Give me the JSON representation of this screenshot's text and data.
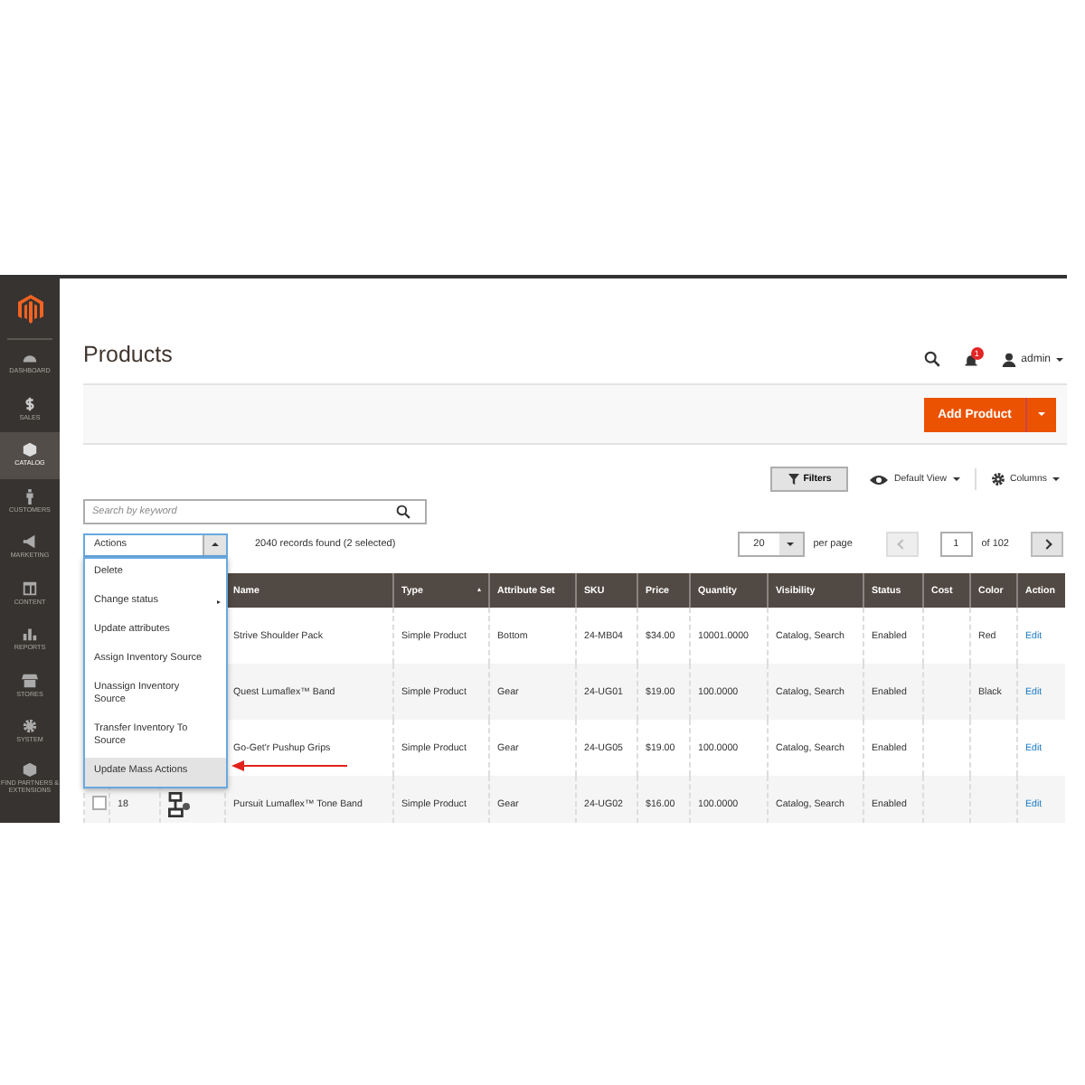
{
  "sidebar": {
    "items": [
      {
        "label": "DASHBOARD",
        "selected": false
      },
      {
        "label": "SALES",
        "selected": false
      },
      {
        "label": "CATALOG",
        "selected": true
      },
      {
        "label": "CUSTOMERS",
        "selected": false
      },
      {
        "label": "MARKETING",
        "selected": false
      },
      {
        "label": "CONTENT",
        "selected": false
      },
      {
        "label": "REPORTS",
        "selected": false
      },
      {
        "label": "STORES",
        "selected": false
      },
      {
        "label": "SYSTEM",
        "selected": false
      },
      {
        "label": "FIND PARTNERS & EXTENSIONS",
        "selected": false
      }
    ]
  },
  "page_title": "Products",
  "header": {
    "notifications": "1",
    "user": "admin"
  },
  "add_button": "Add Product",
  "toolbar": {
    "filters": "Filters",
    "view": "Default View",
    "columns": "Columns"
  },
  "search": {
    "placeholder": "Search by keyword"
  },
  "actions": {
    "label": "Actions",
    "expanded": true,
    "menu": [
      {
        "label": "Delete",
        "has_submenu": false,
        "selected": false
      },
      {
        "label": "Change status",
        "has_submenu": true,
        "selected": false
      },
      {
        "label": "Update attributes",
        "has_submenu": false,
        "selected": false
      },
      {
        "label": "Assign Inventory Source",
        "has_submenu": false,
        "selected": false
      },
      {
        "label": "Unassign Inventory Source",
        "has_submenu": false,
        "selected": false
      },
      {
        "label": "Transfer Inventory To Source",
        "has_submenu": false,
        "selected": false
      },
      {
        "label": "Update Mass Actions",
        "has_submenu": false,
        "selected": true
      }
    ]
  },
  "records": "2040 records found (2 selected)",
  "pager": {
    "per_page": "20",
    "per_page_label": "per page",
    "page": "1",
    "of": "of 102"
  },
  "table": {
    "columns": [
      {
        "label": "Name",
        "sorted": false
      },
      {
        "label": "Type",
        "sorted": true
      },
      {
        "label": "Attribute Set",
        "sorted": false
      },
      {
        "label": "SKU",
        "sorted": false
      },
      {
        "label": "Price",
        "sorted": false
      },
      {
        "label": "Quantity",
        "sorted": false
      },
      {
        "label": "Visibility",
        "sorted": false
      },
      {
        "label": "Status",
        "sorted": false
      },
      {
        "label": "Cost",
        "sorted": false
      },
      {
        "label": "Color",
        "sorted": false
      },
      {
        "label": "Action",
        "sorted": false
      }
    ],
    "rows": [
      {
        "cells": [
          "Strive Shoulder Pack",
          "Simple Product",
          "Bottom",
          "24-MB04",
          "$34.00",
          "10001.0000",
          "Catalog, Search",
          "Enabled",
          "",
          "Red",
          "Edit"
        ]
      },
      {
        "cells": [
          "Quest Lumaflex™ Band",
          "Simple Product",
          "Gear",
          "24-UG01",
          "$19.00",
          "100.0000",
          "Catalog, Search",
          "Enabled",
          "",
          "Black",
          "Edit"
        ]
      },
      {
        "cells": [
          "Go-Get'r Pushup Grips",
          "Simple Product",
          "Gear",
          "24-UG05",
          "$19.00",
          "100.0000",
          "Catalog, Search",
          "Enabled",
          "",
          "",
          "Edit"
        ]
      },
      {
        "id": "18",
        "checked": false,
        "cells": [
          "Pursuit Lumaflex™ Tone Band",
          "Simple Product",
          "Gear",
          "24-UG02",
          "$16.00",
          "100.0000",
          "Catalog, Search",
          "Enabled",
          "",
          "",
          "Edit"
        ]
      }
    ]
  }
}
